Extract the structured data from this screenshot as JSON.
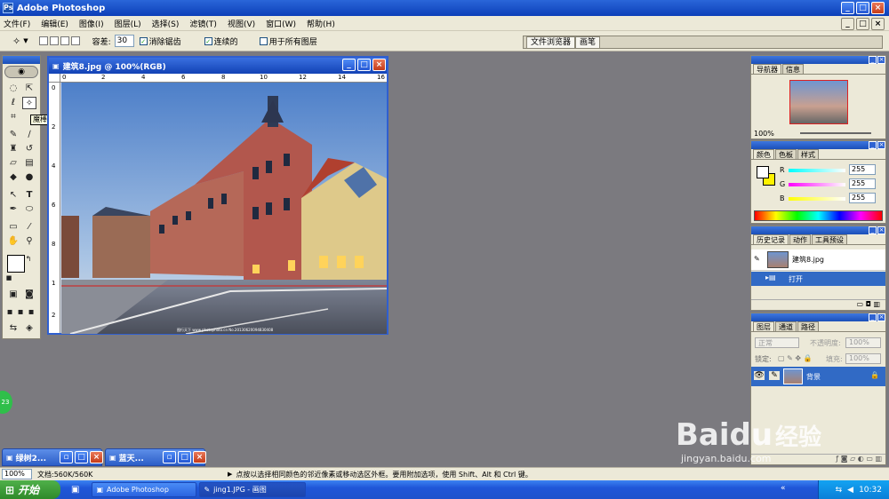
{
  "app": {
    "title": "Adobe Photoshop"
  },
  "menu": [
    "文件(F)",
    "编辑(E)",
    "图像(I)",
    "图层(L)",
    "选择(S)",
    "滤镜(T)",
    "视图(V)",
    "窗口(W)",
    "帮助(H)"
  ],
  "options": {
    "tolerance_label": "容差:",
    "tolerance_value": "30",
    "antialias_label": "消除锯齿",
    "contiguous_label": "连续的",
    "all_layers_label": "用于所有图层",
    "file_browser_label": "文件浏览器",
    "brushes_label": "画笔"
  },
  "tooltip": "魔棒工具(W)",
  "document": {
    "title": "建筑8.jpg @ 100%(RGB)",
    "ruler_h": [
      "0",
      "2",
      "4",
      "6",
      "8",
      "10",
      "12",
      "14",
      "16"
    ],
    "ruler_v": [
      "0",
      "2",
      "4",
      "6",
      "8",
      "1",
      "2"
    ],
    "watermark": "图行天下 www.photophoto.cn  No.20130620094830408"
  },
  "navigator": {
    "tabs": [
      "导航器",
      "信息"
    ],
    "zoom": "100%"
  },
  "color": {
    "tabs": [
      "颜色",
      "色板",
      "样式"
    ],
    "r_label": "R",
    "g_label": "G",
    "b_label": "B",
    "r": "255",
    "g": "255",
    "b": "255"
  },
  "history": {
    "tabs": [
      "历史记录",
      "动作",
      "工具预设"
    ],
    "snapshot": "建筑8.jpg",
    "step": "打开"
  },
  "layers": {
    "tabs": [
      "图层",
      "通道",
      "路径"
    ],
    "blend_mode": "正常",
    "opacity_label": "不透明度:",
    "opacity": "100%",
    "lock_label": "锁定:",
    "fill_label": "填充:",
    "fill": "100%",
    "layer_name": "背景"
  },
  "minimized": [
    {
      "label": "绿树2..."
    },
    {
      "label": "蓝天..."
    }
  ],
  "status": {
    "zoom": "100%",
    "doc": "文档:560K/560K",
    "hint": "点按以选择相同颜色的邻近像素或移动选区外框。要用附加选项，使用 Shift、Alt 和 Ctrl 键。"
  },
  "badge": "23",
  "watermark": {
    "logo": "Baidu",
    "cn": "经验",
    "url": "jingyan.baidu.com"
  },
  "taskbar": {
    "start": "开始",
    "items": [
      "Adobe Photoshop",
      "jing1.JPG - 画图"
    ],
    "clock": "10:32"
  }
}
